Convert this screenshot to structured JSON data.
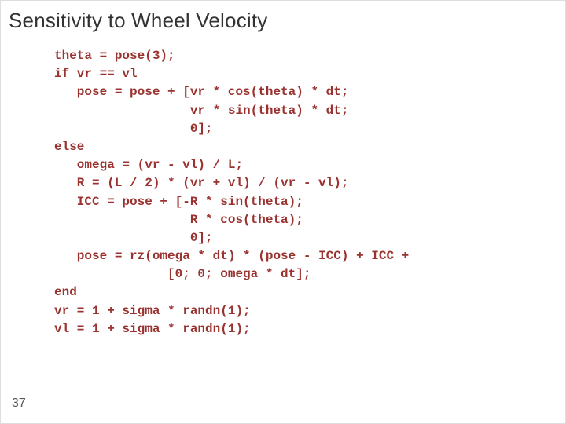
{
  "title": "Sensitivity to Wheel Velocity",
  "code": "theta = pose(3);\nif vr == vl\n   pose = pose + [vr * cos(theta) * dt;\n                  vr * sin(theta) * dt;\n                  0];\nelse\n   omega = (vr - vl) / L;\n   R = (L / 2) * (vr + vl) / (vr - vl);\n   ICC = pose + [-R * sin(theta);\n                  R * cos(theta);\n                  0];\n   pose = rz(omega * dt) * (pose - ICC) + ICC +\n               [0; 0; omega * dt];\nend\nvr = 1 + sigma * randn(1);\nvl = 1 + sigma * randn(1);",
  "page_number": "37"
}
